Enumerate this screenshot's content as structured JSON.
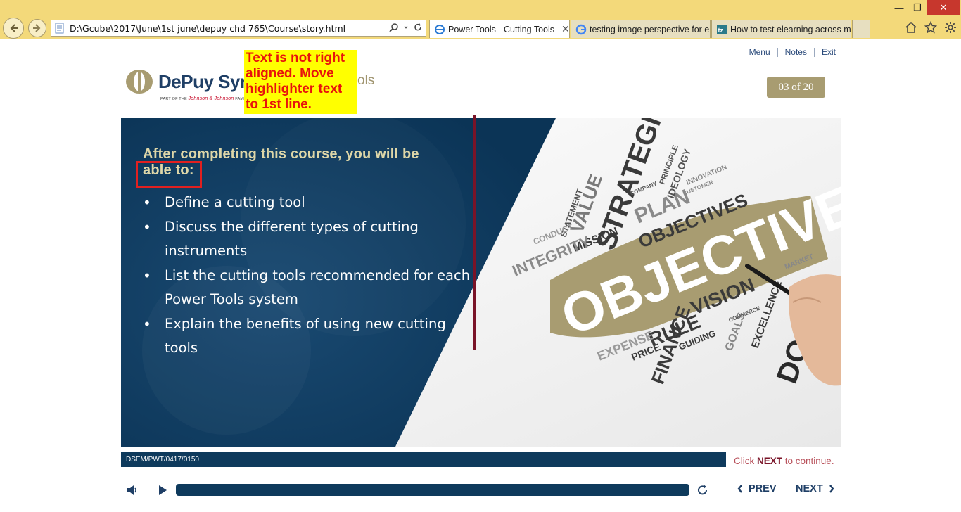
{
  "browser": {
    "url": "D:\\Gcube\\2017\\June\\1st june\\depuy chd 765\\Course\\story.html",
    "tabs": [
      {
        "label": "Power Tools - Cutting Tools",
        "active": true,
        "icon": "ie-page-icon"
      },
      {
        "label": "testing image perspective for e...",
        "active": false,
        "icon": "google-icon"
      },
      {
        "label": "How to test elearning across m...",
        "active": false,
        "icon": "tz-icon"
      }
    ],
    "window_controls": [
      "minimize",
      "restore",
      "close"
    ],
    "toolbar_icons": [
      "home-icon",
      "star-icon",
      "gear-icon"
    ]
  },
  "course": {
    "top_links": [
      "Menu",
      "Notes",
      "Exit"
    ],
    "logo": {
      "brand": "DePuy Synt",
      "sub_prefix": "PART OF THE",
      "sub_company": "Johnson & Johnson",
      "sub_suffix": "FAMILY"
    },
    "title_tail": "ols",
    "page_indicator": "03 of 20",
    "review_note": "Text is not right aligned. Move highlighter text to 1st line.",
    "slide": {
      "heading_line1": "After completing this course, you will be",
      "heading_line2": "able to:",
      "objectives": [
        "Define a cutting tool",
        "Discuss the different types of cutting instruments",
        "List the cutting tools recommended for each Power Tools system",
        "Explain the benefits of using new cutting tools"
      ],
      "image_words": {
        "main": "OBJECTIVES",
        "words": [
          "STRATEGIC",
          "VALUE",
          "PLAN",
          "OBJECTIVES",
          "MISSION",
          "INTEGRITY",
          "STATEMENT",
          "IDEOLOGY",
          "PRINCIPLE",
          "COMPANY",
          "INNOVATION",
          "CUSTOMER",
          "CONDUCT",
          "VISION",
          "RULE",
          "FINANCE",
          "EXPENSE",
          "PRICE",
          "GUIDING",
          "GOALS",
          "COMMERCE",
          "EXCELLENCE",
          "MARKET",
          "DOCT"
        ]
      }
    },
    "course_code": "DSEM/PWT/0417/0150",
    "continue_prefix": "Click ",
    "continue_action": "NEXT",
    "continue_suffix": " to continue.",
    "player": {
      "prev_label": "PREV",
      "next_label": "NEXT",
      "progress": 0.0
    },
    "colors": {
      "navy": "#0e3a5c",
      "gold": "#a89c71",
      "maroon": "#7a1428",
      "note_bg": "#ffff00",
      "note_text": "#e8130c"
    }
  }
}
